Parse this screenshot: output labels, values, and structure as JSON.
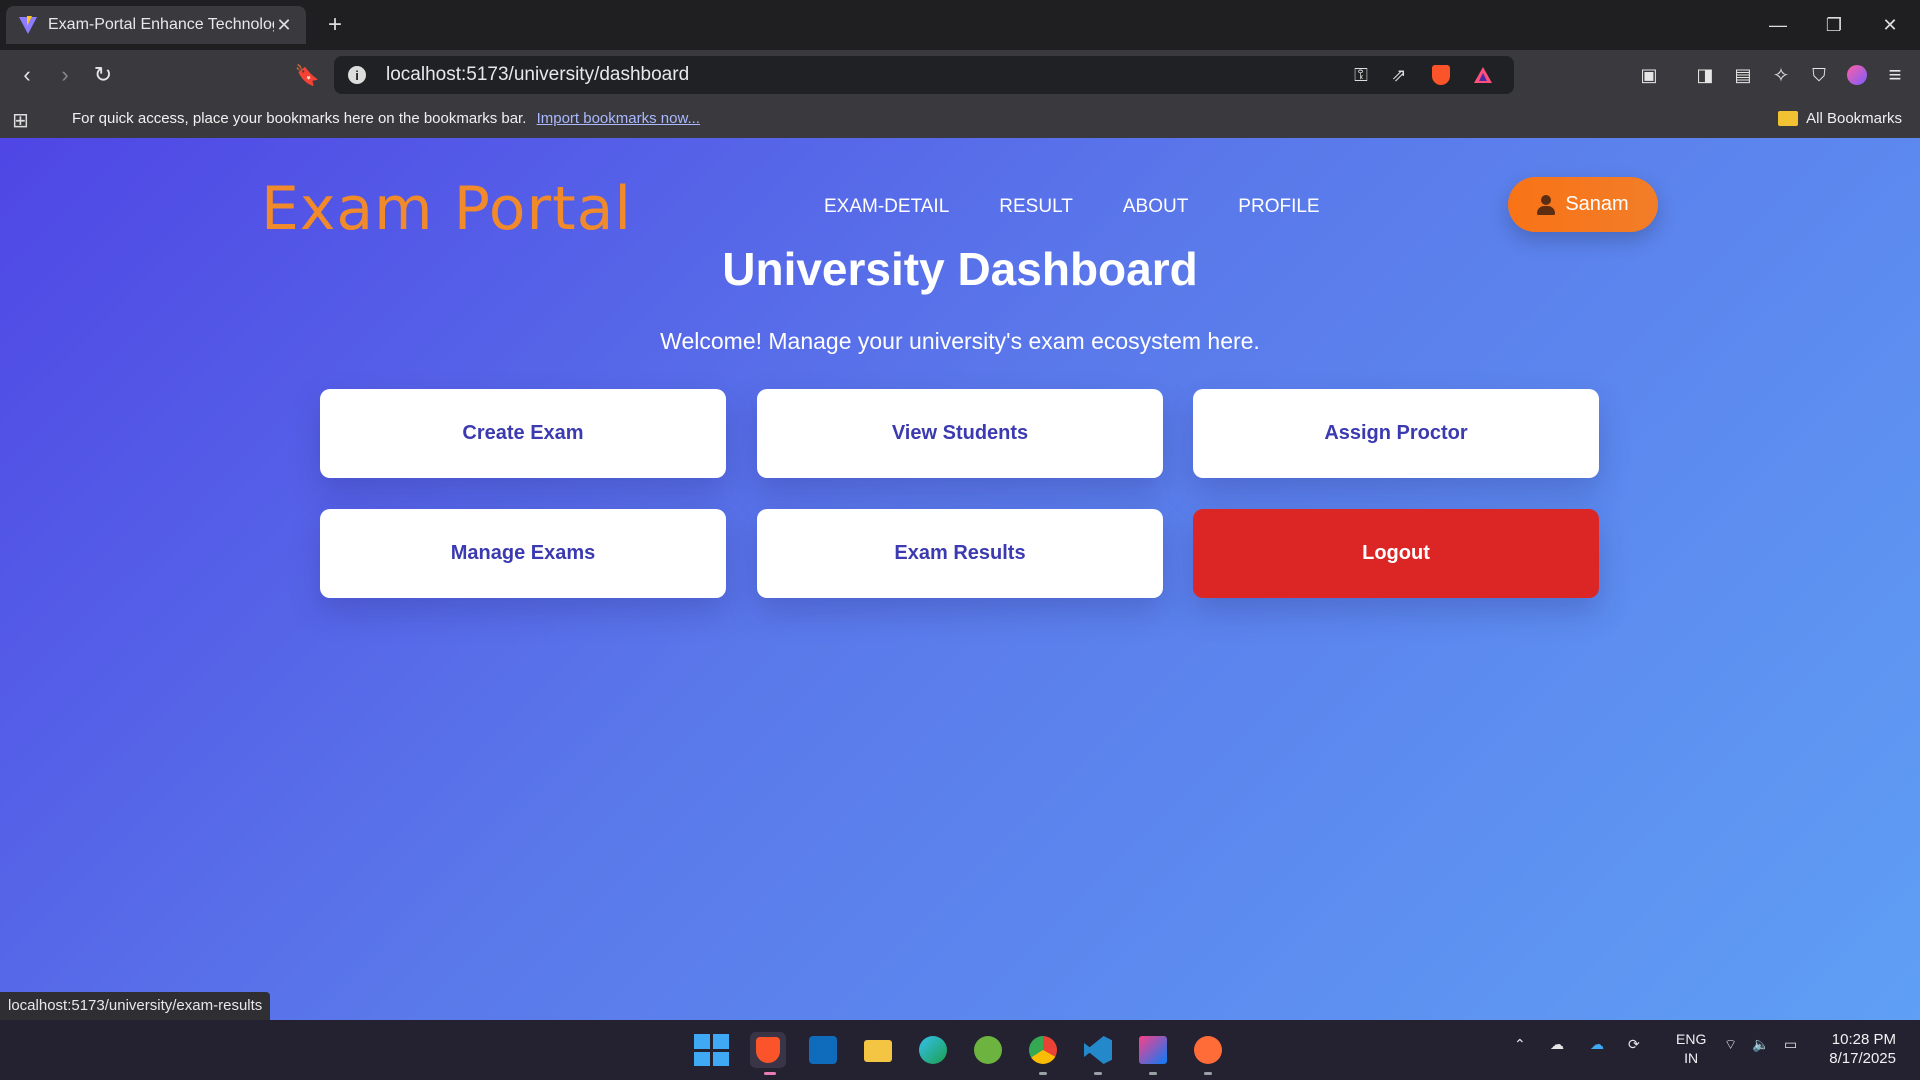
{
  "browser": {
    "tab_title": "Exam-Portal Enhance Technologie",
    "url": "localhost:5173/university/dashboard",
    "bookmarks_hint": "For quick access, place your bookmarks here on the bookmarks bar.",
    "bookmarks_link": "Import bookmarks now...",
    "all_bookmarks": "All Bookmarks",
    "status_url": "localhost:5173/university/exam-results"
  },
  "app": {
    "brand": "Exam Portal",
    "nav": [
      "EXAM-DETAIL",
      "RESULT",
      "ABOUT",
      "PROFILE"
    ],
    "user_name": "Sanam"
  },
  "dashboard": {
    "title": "University Dashboard",
    "subtitle": "Welcome! Manage your university's exam ecosystem here.",
    "actions": [
      "Create Exam",
      "View Students",
      "Assign Proctor",
      "Manage Exams",
      "Exam Results",
      "Logout"
    ]
  },
  "taskbar": {
    "language": "ENG",
    "region": "IN",
    "time": "10:28 PM",
    "date": "8/17/2025"
  },
  "colors": {
    "brand": "#f08a2a",
    "card_text": "#3b3ab0",
    "logout": "#dc2626",
    "user_button": "#f97316"
  }
}
